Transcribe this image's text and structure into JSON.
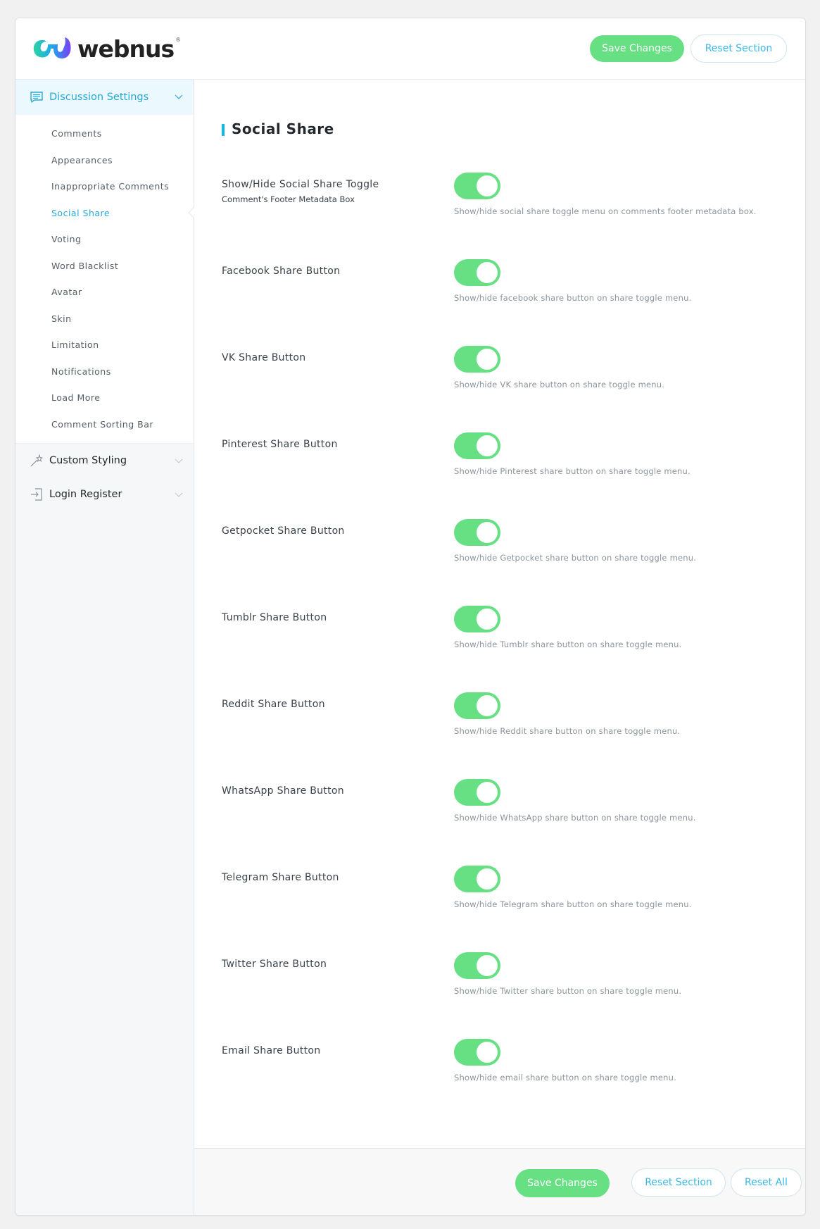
{
  "brand": {
    "name": "webnus",
    "registered": "®",
    "accent": "#12b7ed",
    "toggle_on_color": "#66e083"
  },
  "header": {
    "save_label": "Save Changes",
    "reset_section_label": "Reset Section"
  },
  "sidebar": {
    "groups": [
      {
        "label": "Discussion Settings",
        "icon": "comment-icon",
        "expanded": true,
        "items": [
          {
            "label": "Comments",
            "active": false
          },
          {
            "label": "Appearances",
            "active": false
          },
          {
            "label": "Inappropriate Comments",
            "active": false
          },
          {
            "label": "Social Share",
            "active": true
          },
          {
            "label": "Voting",
            "active": false
          },
          {
            "label": "Word Blacklist",
            "active": false
          },
          {
            "label": "Avatar",
            "active": false
          },
          {
            "label": "Skin",
            "active": false
          },
          {
            "label": "Limitation",
            "active": false
          },
          {
            "label": "Notifications",
            "active": false
          },
          {
            "label": "Load More",
            "active": false
          },
          {
            "label": "Comment Sorting Bar",
            "active": false
          }
        ]
      },
      {
        "label": "Custom Styling",
        "icon": "magic-wand-icon",
        "expanded": false
      },
      {
        "label": "Login Register",
        "icon": "login-icon",
        "expanded": false
      }
    ]
  },
  "main": {
    "section_title": "Social Share",
    "settings": [
      {
        "title": "Show/Hide Social Share Toggle",
        "subtitle": "Comment's Footer Metadata Box",
        "enabled": true,
        "description": "Show/hide social share toggle menu on comments footer metadata box."
      },
      {
        "title": "Facebook Share Button",
        "enabled": true,
        "description": "Show/hide facebook share button on share toggle menu."
      },
      {
        "title": "VK Share Button",
        "enabled": true,
        "description": "Show/hide VK share button on share toggle menu."
      },
      {
        "title": "Pinterest Share Button",
        "enabled": true,
        "description": "Show/hide Pinterest share button on share toggle menu."
      },
      {
        "title": "Getpocket Share Button",
        "enabled": true,
        "description": "Show/hide Getpocket share button on share toggle menu."
      },
      {
        "title": "Tumblr Share Button",
        "enabled": true,
        "description": "Show/hide Tumblr share button on share toggle menu."
      },
      {
        "title": "Reddit Share Button",
        "enabled": true,
        "description": "Show/hide Reddit share button on share toggle menu."
      },
      {
        "title": "WhatsApp Share Button",
        "enabled": true,
        "description": "Show/hide WhatsApp share button on share toggle menu."
      },
      {
        "title": "Telegram Share Button",
        "enabled": true,
        "description": "Show/hide Telegram share button on share toggle menu."
      },
      {
        "title": "Twitter Share Button",
        "enabled": true,
        "description": "Show/hide Twitter share button on share toggle menu."
      },
      {
        "title": "Email Share Button",
        "enabled": true,
        "description": "Show/hide email share button on share toggle menu."
      }
    ]
  },
  "footer": {
    "save_label": "Save Changes",
    "reset_section_label": "Reset Section",
    "reset_all_label": "Reset All"
  }
}
